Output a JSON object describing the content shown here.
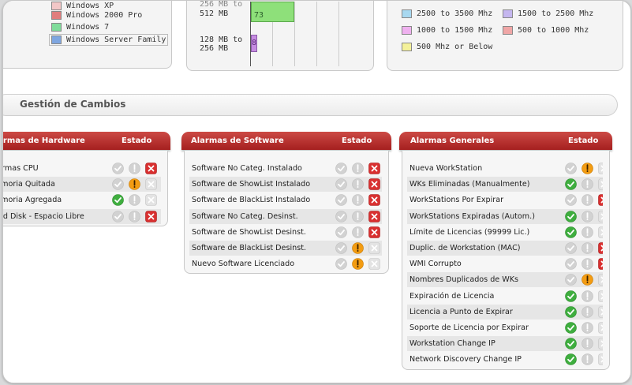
{
  "top": {
    "os_legend": [
      "Windows XP",
      "Windows 2000 Pro",
      "Windows 7",
      "Windows Server Family"
    ],
    "os_colors": [
      "#f2c7c7",
      "#e07d7d",
      "#7fdc9a",
      "#7fa6e0"
    ],
    "ram_labels": [
      "256 MB to",
      "512 MB",
      "128 MB to",
      "256 MB"
    ],
    "ram_bars": [
      {
        "value_label": "73",
        "color": "#8ee07a"
      },
      {
        "value_label": "8",
        "color": "#c58be0"
      }
    ],
    "cpu_legend": [
      "2500 to 3500 Mhz",
      "1500 to 2500 Mhz",
      "1000 to 1500 Mhz",
      "500 to 1000 Mhz",
      "500 Mhz or Below"
    ],
    "cpu_colors": [
      "#a7d8f0",
      "#c4b6ef",
      "#efb1ef",
      "#f0a6a6",
      "#f4f19a"
    ]
  },
  "section": {
    "title": "Gestión de Cambios"
  },
  "panels": [
    {
      "title": "Alarmas de Hardware",
      "state_label": "Estado",
      "rows": [
        {
          "label": "Alarmas CPU",
          "state": [
            0,
            0,
            1
          ]
        },
        {
          "label": "Memoria Quitada",
          "state": [
            0,
            1,
            0
          ]
        },
        {
          "label": "Memoria Agregada",
          "state": [
            1,
            0,
            0
          ]
        },
        {
          "label": "Hard Disk - Espacio Libre",
          "state": [
            0,
            0,
            1
          ]
        }
      ]
    },
    {
      "title": "Alarmas de Software",
      "state_label": "Estado",
      "rows": [
        {
          "label": "Software No Categ. Instalado",
          "state": [
            0,
            0,
            1
          ]
        },
        {
          "label": "Software de ShowList Instalado",
          "state": [
            0,
            0,
            1
          ]
        },
        {
          "label": "Software de BlackList Instalado",
          "state": [
            0,
            0,
            1
          ]
        },
        {
          "label": "Software No Categ. Desinst.",
          "state": [
            0,
            0,
            1
          ]
        },
        {
          "label": "Software de ShowList Desinst.",
          "state": [
            0,
            0,
            1
          ]
        },
        {
          "label": "Software de BlackList Desinst.",
          "state": [
            0,
            1,
            0
          ]
        },
        {
          "label": "Nuevo Software Licenciado",
          "state": [
            0,
            1,
            0
          ]
        }
      ]
    },
    {
      "title": "Alarmas Generales",
      "state_label": "Estado",
      "rows": [
        {
          "label": "Nueva WorkStation",
          "state": [
            0,
            1,
            0
          ]
        },
        {
          "label": "WKs Eliminadas (Manualmente)",
          "state": [
            1,
            0,
            0
          ]
        },
        {
          "label": "WorkStations Por Expirar",
          "state": [
            0,
            0,
            1
          ]
        },
        {
          "label": "WorkStations Expiradas (Autom.)",
          "state": [
            1,
            0,
            0
          ]
        },
        {
          "label": "Límite de Licencias (99999 Lic.)",
          "state": [
            1,
            0,
            0
          ]
        },
        {
          "label": "Duplic. de Workstation (MAC)",
          "state": [
            0,
            0,
            1
          ]
        },
        {
          "label": "WMI Corrupto",
          "state": [
            0,
            0,
            1
          ]
        },
        {
          "label": "Nombres Duplicados de WKs",
          "state": [
            0,
            1,
            0
          ]
        },
        {
          "label": "Expiración de Licencia",
          "state": [
            1,
            0,
            0
          ]
        },
        {
          "label": "Licencia a Punto de Expirar",
          "state": [
            1,
            0,
            0
          ]
        },
        {
          "label": "Soporte de Licencia por Expirar",
          "state": [
            1,
            0,
            0
          ]
        },
        {
          "label": "Workstation Change IP",
          "state": [
            1,
            0,
            0
          ]
        },
        {
          "label": "Network Discovery Change IP",
          "state": [
            1,
            0,
            0
          ]
        }
      ]
    }
  ]
}
